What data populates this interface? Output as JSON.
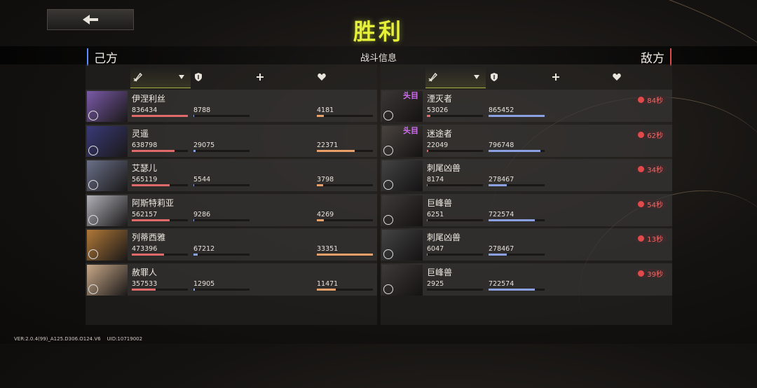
{
  "title": "胜利",
  "header": {
    "left": "己方",
    "center": "战斗信息",
    "right": "敌方"
  },
  "footer": {
    "version": "VER:2.0.4(99)_A125.D306.O124.V6",
    "uid": "UID:10719002"
  },
  "colors": {
    "title": "#e6f13a",
    "damage_bar": "#e06a6a",
    "taken_bar": "#8aa0e0",
    "heal_bar": "#e8a068",
    "timer": "#f06a6a"
  },
  "columns": [
    "sword-icon",
    "shield-icon",
    "plus-icon",
    "heart-icon"
  ],
  "allies": [
    {
      "name": "伊涅利丝",
      "damage": "836434",
      "damage_pct": 1.0,
      "taken": "8788",
      "taken_pct": 0.01,
      "heal": "4181",
      "heal_pct": 0.13
    },
    {
      "name": "灵遥",
      "damage": "638798",
      "damage_pct": 0.76,
      "taken": "29075",
      "taken_pct": 0.04,
      "heal": "22371",
      "heal_pct": 0.67
    },
    {
      "name": "艾瑟儿",
      "damage": "565119",
      "damage_pct": 0.68,
      "taken": "5544",
      "taken_pct": 0.01,
      "heal": "3798",
      "heal_pct": 0.11
    },
    {
      "name": "阿斯特莉亚",
      "damage": "562157",
      "damage_pct": 0.67,
      "taken": "9286",
      "taken_pct": 0.01,
      "heal": "4269",
      "heal_pct": 0.13
    },
    {
      "name": "列蒂西雅",
      "damage": "473396",
      "damage_pct": 0.57,
      "taken": "67212",
      "taken_pct": 0.08,
      "heal": "33351",
      "heal_pct": 1.0
    },
    {
      "name": "赦罪人",
      "damage": "357533",
      "damage_pct": 0.43,
      "taken": "12905",
      "taken_pct": 0.02,
      "heal": "11471",
      "heal_pct": 0.34
    }
  ],
  "enemies": [
    {
      "name": "湮灭者",
      "boss": "头目",
      "damage": "53026",
      "damage_pct": 0.06,
      "taken": "865452",
      "taken_pct": 1.0,
      "time": "84秒"
    },
    {
      "name": "迷途者",
      "boss": "头目",
      "damage": "22049",
      "damage_pct": 0.03,
      "taken": "796748",
      "taken_pct": 0.92,
      "time": "62秒"
    },
    {
      "name": "刺尾凶兽",
      "boss": "",
      "damage": "8174",
      "damage_pct": 0.01,
      "taken": "278467",
      "taken_pct": 0.32,
      "time": "34秒"
    },
    {
      "name": "巨峰兽",
      "boss": "",
      "damage": "6251",
      "damage_pct": 0.01,
      "taken": "722574",
      "taken_pct": 0.83,
      "time": "54秒"
    },
    {
      "name": "刺尾凶兽",
      "boss": "",
      "damage": "6047",
      "damage_pct": 0.01,
      "taken": "278467",
      "taken_pct": 0.32,
      "time": "13秒"
    },
    {
      "name": "巨峰兽",
      "boss": "",
      "damage": "2925",
      "damage_pct": 0.0,
      "taken": "722574",
      "taken_pct": 0.83,
      "time": "39秒"
    }
  ]
}
